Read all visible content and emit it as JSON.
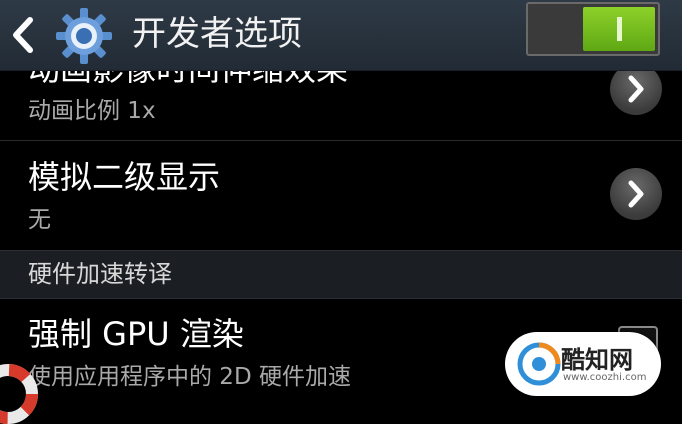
{
  "action_bar": {
    "title": "开发者选项",
    "back_icon": "chevron-left-icon",
    "settings_icon": "gear-icon",
    "master_switch_on": true,
    "accent_color": "#7cc31f"
  },
  "rows": [
    {
      "title": "动画影像时间伸缩效果",
      "subtitle": "动画比例 1x",
      "icon": "chevron-right-icon"
    },
    {
      "title": "模拟二级显示",
      "subtitle": "无",
      "icon": "chevron-right-icon"
    }
  ],
  "section": {
    "label": "硬件加速转译"
  },
  "gpu_row": {
    "title": "强制 GPU 渲染",
    "subtitle": "使用应用程序中的 2D 硬件加速",
    "checked": false
  },
  "watermark": {
    "name": "酷知网",
    "url": "www.coozhi.com"
  }
}
